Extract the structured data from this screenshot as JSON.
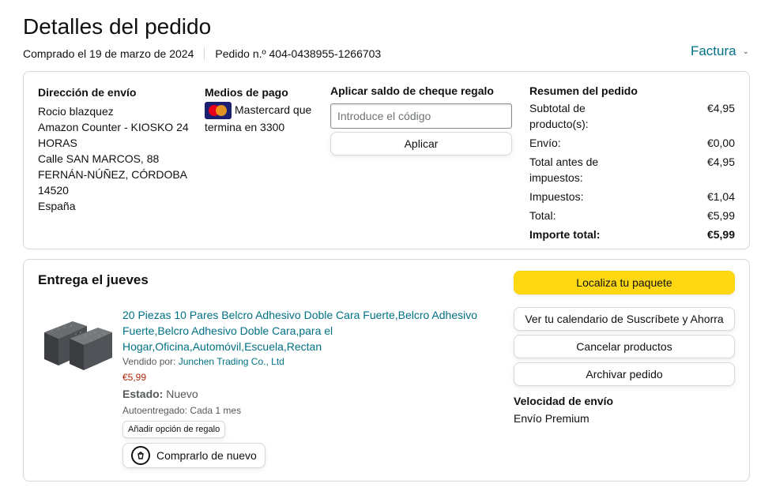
{
  "header": {
    "title": "Detalles del pedido",
    "purchased": "Comprado el 19 de marzo de 2024",
    "order_number": "Pedido n.º 404-0438955-1266703",
    "invoice_label": "Factura",
    "invoice_chevron": "⌄"
  },
  "shipping": {
    "title": "Dirección de envío",
    "lines": [
      "Rocio blazquez",
      "Amazon Counter - KIOSKO 24 HORAS",
      "Calle SAN MARCOS, 88",
      "FERNÁN-NÚÑEZ, CÓRDOBA",
      "14520",
      "España"
    ]
  },
  "payment": {
    "title": "Medios de pago",
    "card_text": "Mastercard que termina en 3300",
    "card_icon": "mastercard-icon"
  },
  "gift_card": {
    "title": "Aplicar saldo de cheque regalo",
    "placeholder": "Introduce el código",
    "apply_label": "Aplicar"
  },
  "summary": {
    "title": "Resumen del pedido",
    "rows": [
      {
        "label": "Subtotal de producto(s):",
        "value": "€4,95"
      },
      {
        "label": "Envío:",
        "value": "€0,00"
      },
      {
        "label": "Total antes de impuestos:",
        "value": "€4,95"
      },
      {
        "label": "Impuestos:",
        "value": "€1,04"
      },
      {
        "label": "Total:",
        "value": "€5,99"
      }
    ],
    "grand_total_label": "Importe total:",
    "grand_total_value": "€5,99"
  },
  "delivery": {
    "title": "Entrega el jueves",
    "product": {
      "title": "20 Piezas 10 Pares Belcro Adhesivo Doble Cara Fuerte,Belcro Adhesivo Fuerte,Belcro Adhesivo Doble Cara,para el Hogar,Oficina,Automóvil,Escuela,Rectan",
      "sold_by_label": "Vendido por:",
      "seller": "Junchen Trading Co., Ltd",
      "price": "€5,99",
      "status_label": "Estado:",
      "status_value": "Nuevo",
      "autodelivery": "Autoentregado: Cada 1 mes",
      "gift_option": "Añadir opción de regalo",
      "buy_again": "Comprarlo de nuevo"
    },
    "actions": {
      "track": "Localiza tu paquete",
      "subscribe": "Ver tu calendario de Suscríbete y Ahorra",
      "cancel": "Cancelar productos",
      "archive": "Archivar pedido"
    },
    "speed_title": "Velocidad de envío",
    "speed_value": "Envío Premium"
  },
  "colors": {
    "link": "#007185",
    "primary_button": "#ffd814",
    "price": "#b12704"
  }
}
